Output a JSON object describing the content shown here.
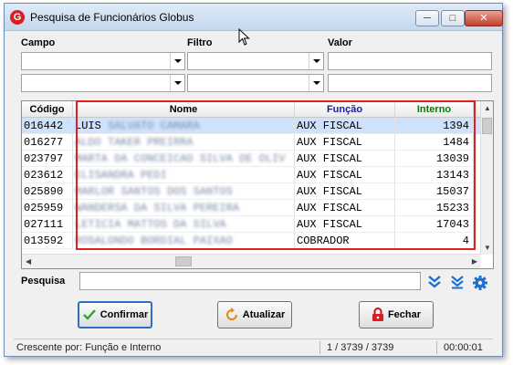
{
  "window": {
    "title": "Pesquisa de Funcionários Globus",
    "icon_letter": "G"
  },
  "filters": {
    "campo_label": "Campo",
    "filtro_label": "Filtro",
    "valor_label": "Valor"
  },
  "grid": {
    "columns": [
      "Código",
      "Nome",
      "Função",
      "Interno"
    ],
    "column_colors": {
      "Código": "#000000",
      "Nome": "#000000",
      "Função": "#1a1aa6",
      "Interno": "#0a7a0a"
    },
    "rows": [
      {
        "codigo": "016442",
        "nome": "LUIS",
        "nome_obscured": "SALVATO CAMARA",
        "funcao": "AUX FISCAL",
        "interno": "1394"
      },
      {
        "codigo": "016277",
        "nome": "",
        "nome_obscured": "ALDO TAKER PREIRRA",
        "funcao": "AUX FISCAL",
        "interno": "1484"
      },
      {
        "codigo": "023797",
        "nome": "",
        "nome_obscured": "MARTA DA CONCEICAO SILVA DE OLIV",
        "funcao": "AUX FISCAL",
        "interno": "13039"
      },
      {
        "codigo": "023612",
        "nome": "",
        "nome_obscured": "ELISANDRA PEDI",
        "funcao": "AUX FISCAL",
        "interno": "13143"
      },
      {
        "codigo": "025890",
        "nome": "",
        "nome_obscured": "MARLOR SANTOS DOS SANTOS",
        "funcao": "AUX FISCAL",
        "interno": "15037"
      },
      {
        "codigo": "025959",
        "nome": "",
        "nome_obscured": "WANDERSA DA SILVA PEREIRA",
        "funcao": "AUX FISCAL",
        "interno": "15233"
      },
      {
        "codigo": "027111",
        "nome": "",
        "nome_obscured": "LETICIA MATTOS DA SILVA",
        "funcao": "AUX FISCAL",
        "interno": "17043"
      },
      {
        "codigo": "013592",
        "nome": "",
        "nome_obscured": "ROSALONDO BORDIAL PAIXAO",
        "funcao": "COBRADOR",
        "interno": "4"
      }
    ],
    "selected_index": 0,
    "selection_color": "#cfe2fb"
  },
  "search": {
    "label": "Pesquisa",
    "value": ""
  },
  "buttons": {
    "confirmar": "Confirmar",
    "atualizar": "Atualizar",
    "fechar": "Fechar"
  },
  "status": {
    "sort_text": "Crescente por: Função e Interno",
    "record_text": "1 / 3739 / 3739",
    "timer": "00:00:01"
  },
  "colors": {
    "highlight_box": "#e0201e",
    "brand_red": "#d81e24",
    "icon_blue": "#1f6fd0"
  }
}
